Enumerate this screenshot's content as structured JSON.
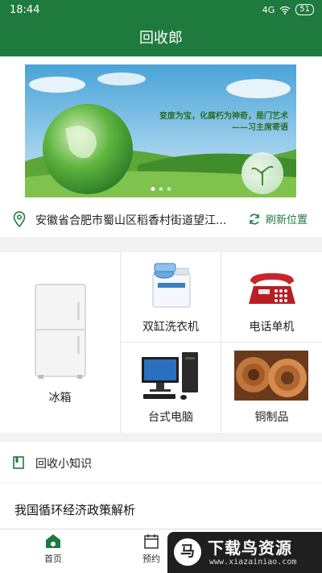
{
  "status_bar": {
    "time": "18:44",
    "signal": "4G",
    "battery": "51"
  },
  "app_bar": {
    "title": "回收郎"
  },
  "banner": {
    "caption_line1": "变废为宝，化腐朽为神奇，是门艺术",
    "caption_line2": "——习主席寄语",
    "slide_count": 3,
    "active_slide": 0
  },
  "location": {
    "address": "安徽省合肥市蜀山区稻香村街道望江...",
    "refresh_label": "刷新位置"
  },
  "categories": [
    {
      "label": "冰箱",
      "icon": "fridge"
    },
    {
      "label": "双缸洗衣机",
      "icon": "washing-machine"
    },
    {
      "label": "电话单机",
      "icon": "telephone"
    },
    {
      "label": "台式电脑",
      "icon": "desktop-computer"
    },
    {
      "label": "铜制品",
      "icon": "copper-wire"
    }
  ],
  "knowledge": {
    "title": "回收小知识",
    "articles": [
      {
        "title": "我国循环经济政策解析"
      }
    ]
  },
  "tabs": [
    {
      "label": "首页",
      "icon": "home"
    },
    {
      "label": "预约",
      "icon": "calendar"
    }
  ],
  "watermark": {
    "logo_char": "马",
    "title": "下载鸟资源",
    "url": "www.xiazainiao.com"
  },
  "colors": {
    "primary": "#1e7a3d"
  }
}
